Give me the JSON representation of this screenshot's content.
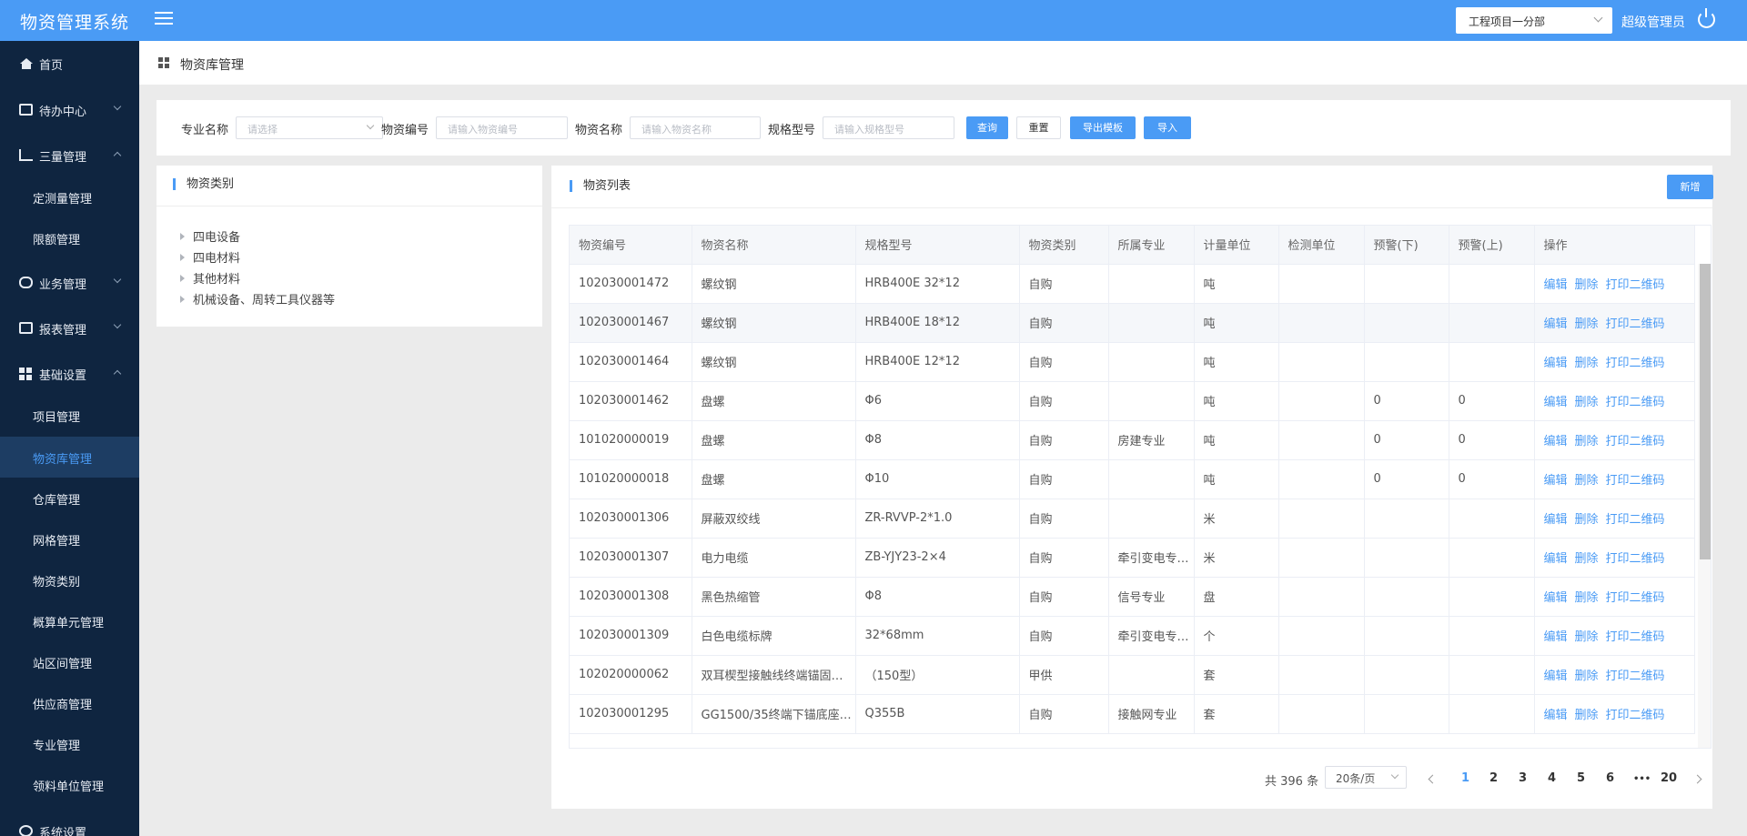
{
  "app": {
    "title": "物资管理系统"
  },
  "header": {
    "project_select": "工程项目一分部",
    "user": "超级管理员"
  },
  "sidebar": {
    "items": [
      {
        "label": "首页"
      },
      {
        "label": "待办中心"
      },
      {
        "label": "三量管理"
      },
      {
        "label": "定测量管理"
      },
      {
        "label": "限额管理"
      },
      {
        "label": "业务管理"
      },
      {
        "label": "报表管理"
      },
      {
        "label": "基础设置"
      },
      {
        "label": "项目管理"
      },
      {
        "label": "物资库管理"
      },
      {
        "label": "仓库管理"
      },
      {
        "label": "网格管理"
      },
      {
        "label": "物资类别"
      },
      {
        "label": "概算单元管理"
      },
      {
        "label": "站区间管理"
      },
      {
        "label": "供应商管理"
      },
      {
        "label": "专业管理"
      },
      {
        "label": "领料单位管理"
      },
      {
        "label": "系统设置"
      }
    ]
  },
  "page": {
    "title": "物资库管理"
  },
  "filter": {
    "specialty_label": "专业名称",
    "specialty_placeholder": "请选择",
    "code_label": "物资编号",
    "code_placeholder": "请输入物资编号",
    "name_label": "物资名称",
    "name_placeholder": "请输入物资名称",
    "spec_label": "规格型号",
    "spec_placeholder": "请输入规格型号",
    "query": "查询",
    "reset": "重置",
    "export_template": "导出模板",
    "import": "导入"
  },
  "category": {
    "title": "物资类别",
    "items": [
      "四电设备",
      "四电材料",
      "其他材料",
      "机械设备、周转工具仪器等"
    ]
  },
  "list": {
    "title": "物资列表",
    "add": "新增",
    "columns": [
      "物资编号",
      "物资名称",
      "规格型号",
      "物资类别",
      "所属专业",
      "计量单位",
      "检测单位",
      "预警(下)",
      "预警(上)",
      "操作"
    ],
    "actions": {
      "edit": "编辑",
      "delete": "删除",
      "print_qr": "打印二维码"
    },
    "rows": [
      [
        "102030001472",
        "螺纹钢",
        "HRB400E 32*12",
        "自购",
        "",
        "吨",
        "",
        "",
        ""
      ],
      [
        "102030001467",
        "螺纹钢",
        "HRB400E 18*12",
        "自购",
        "",
        "吨",
        "",
        "",
        ""
      ],
      [
        "102030001464",
        "螺纹钢",
        "HRB400E 12*12",
        "自购",
        "",
        "吨",
        "",
        "",
        ""
      ],
      [
        "102030001462",
        "盘螺",
        "Φ6",
        "自购",
        "",
        "吨",
        "",
        "0",
        "0"
      ],
      [
        "101020000019",
        "盘螺",
        "Φ8",
        "自购",
        "房建专业",
        "吨",
        "",
        "0",
        "0"
      ],
      [
        "101020000018",
        "盘螺",
        "Φ10",
        "自购",
        "",
        "吨",
        "",
        "0",
        "0"
      ],
      [
        "102030001306",
        "屏蔽双绞线",
        "ZR-RVVP-2*1.0",
        "自购",
        "",
        "米",
        "",
        "",
        ""
      ],
      [
        "102030001307",
        "电力电缆",
        "ZB-YJY23-2×4",
        "自购",
        "牵引变电专…",
        "米",
        "",
        "",
        ""
      ],
      [
        "102030001308",
        "黑色热缩管",
        "Φ8",
        "自购",
        "信号专业",
        "盘",
        "",
        "",
        ""
      ],
      [
        "102030001309",
        "白色电缆标牌",
        "32*68mm",
        "自购",
        "牵引变电专…",
        "个",
        "",
        "",
        ""
      ],
      [
        "102020000062",
        "双耳楔型接触线终端锚固…",
        "（150型）",
        "甲供",
        "",
        "套",
        "",
        "",
        ""
      ],
      [
        "102030001295",
        "GG1500/35终端下锚底座(…",
        "Q355B",
        "自购",
        "接触网专业",
        "套",
        "",
        "",
        ""
      ]
    ]
  },
  "pagination": {
    "total": "共 396 条",
    "page_size": "20条/页",
    "pages": [
      "1",
      "2",
      "3",
      "4",
      "5",
      "6",
      "•••",
      "20"
    ],
    "current": "1"
  }
}
